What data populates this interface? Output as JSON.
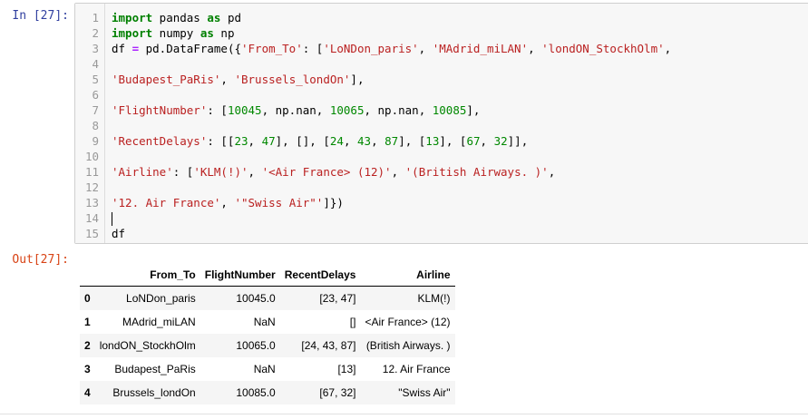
{
  "input_prompt": "In [27]:",
  "output_prompt": "Out[27]:",
  "code_lines": [
    {
      "n": "1",
      "tokens": [
        [
          "kw",
          "import"
        ],
        [
          "t",
          " pandas "
        ],
        [
          "kw",
          "as"
        ],
        [
          "t",
          " pd"
        ]
      ]
    },
    {
      "n": "2",
      "tokens": [
        [
          "kw",
          "import"
        ],
        [
          "t",
          " numpy "
        ],
        [
          "kw",
          "as"
        ],
        [
          "t",
          " np"
        ]
      ]
    },
    {
      "n": "3",
      "tokens": [
        [
          "t",
          "df "
        ],
        [
          "op",
          "="
        ],
        [
          "t",
          " pd.DataFrame({"
        ],
        [
          "str",
          "'From_To'"
        ],
        [
          "t",
          ": ["
        ],
        [
          "str",
          "'LoNDon_paris'"
        ],
        [
          "t",
          ", "
        ],
        [
          "str",
          "'MAdrid_miLAN'"
        ],
        [
          "t",
          ", "
        ],
        [
          "str",
          "'londON_StockhOlm'"
        ],
        [
          "t",
          ","
        ]
      ]
    },
    {
      "n": "4",
      "tokens": []
    },
    {
      "n": "5",
      "tokens": [
        [
          "str",
          "'Budapest_PaRis'"
        ],
        [
          "t",
          ", "
        ],
        [
          "str",
          "'Brussels_londOn'"
        ],
        [
          "t",
          "],"
        ]
      ]
    },
    {
      "n": "6",
      "tokens": []
    },
    {
      "n": "7",
      "tokens": [
        [
          "str",
          "'FlightNumber'"
        ],
        [
          "t",
          ": ["
        ],
        [
          "num",
          "10045"
        ],
        [
          "t",
          ", np.nan, "
        ],
        [
          "num",
          "10065"
        ],
        [
          "t",
          ", np.nan, "
        ],
        [
          "num",
          "10085"
        ],
        [
          "t",
          "],"
        ]
      ]
    },
    {
      "n": "8",
      "tokens": []
    },
    {
      "n": "9",
      "tokens": [
        [
          "str",
          "'RecentDelays'"
        ],
        [
          "t",
          ": [["
        ],
        [
          "num",
          "23"
        ],
        [
          "t",
          ", "
        ],
        [
          "num",
          "47"
        ],
        [
          "t",
          "], [], ["
        ],
        [
          "num",
          "24"
        ],
        [
          "t",
          ", "
        ],
        [
          "num",
          "43"
        ],
        [
          "t",
          ", "
        ],
        [
          "num",
          "87"
        ],
        [
          "t",
          "], ["
        ],
        [
          "num",
          "13"
        ],
        [
          "t",
          "], ["
        ],
        [
          "num",
          "67"
        ],
        [
          "t",
          ", "
        ],
        [
          "num",
          "32"
        ],
        [
          "t",
          "]],"
        ]
      ]
    },
    {
      "n": "10",
      "tokens": []
    },
    {
      "n": "11",
      "tokens": [
        [
          "str",
          "'Airline'"
        ],
        [
          "t",
          ": ["
        ],
        [
          "str",
          "'KLM(!)'"
        ],
        [
          "t",
          ", "
        ],
        [
          "str",
          "'<Air France> (12)'"
        ],
        [
          "t",
          ", "
        ],
        [
          "str",
          "'(British Airways. )'"
        ],
        [
          "t",
          ","
        ]
      ]
    },
    {
      "n": "12",
      "tokens": []
    },
    {
      "n": "13",
      "tokens": [
        [
          "str",
          "'12. Air France'"
        ],
        [
          "t",
          ", "
        ],
        [
          "str",
          "'\"Swiss Air\"'"
        ],
        [
          "t",
          "]})"
        ]
      ]
    },
    {
      "n": "14",
      "tokens": [
        [
          "cursor",
          ""
        ]
      ]
    },
    {
      "n": "15",
      "tokens": [
        [
          "t",
          "df"
        ]
      ]
    }
  ],
  "dataframe": {
    "columns": [
      "",
      "From_To",
      "FlightNumber",
      "RecentDelays",
      "Airline"
    ],
    "rows": [
      [
        "0",
        "LoNDon_paris",
        "10045.0",
        "[23, 47]",
        "KLM(!)"
      ],
      [
        "1",
        "MAdrid_miLAN",
        "NaN",
        "[]",
        "<Air France> (12)"
      ],
      [
        "2",
        "londON_StockhOlm",
        "10065.0",
        "[24, 43, 87]",
        "(British Airways. )"
      ],
      [
        "3",
        "Budapest_PaRis",
        "NaN",
        "[13]",
        "12. Air France"
      ],
      [
        "4",
        "Brussels_londOn",
        "10085.0",
        "[67, 32]",
        "\"Swiss Air\""
      ]
    ]
  }
}
